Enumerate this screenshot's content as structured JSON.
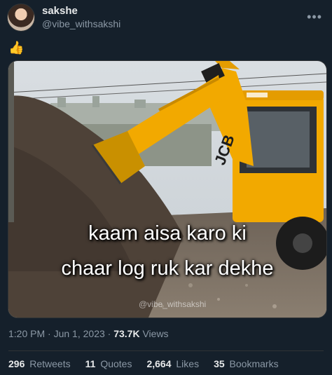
{
  "author": {
    "display_name": "sakshe",
    "handle": "@vibe_withsakshi"
  },
  "tweet": {
    "text": "👍",
    "menu_icon": "more-icon"
  },
  "media": {
    "caption_line1": "kaam aisa karo ki",
    "caption_line2": "chaar log ruk kar dekhe",
    "watermark": "@vibe_withsakshi",
    "brand_text": "JCB"
  },
  "meta": {
    "time": "1:20 PM",
    "date": "Jun 1, 2023",
    "views": "73.7K",
    "views_label": "Views"
  },
  "stats": [
    {
      "value": "296",
      "label": "Retweets"
    },
    {
      "value": "11",
      "label": "Quotes"
    },
    {
      "value": "2,664",
      "label": "Likes"
    },
    {
      "value": "35",
      "label": "Bookmarks"
    }
  ],
  "colors": {
    "background": "#15202b",
    "secondary_text": "#8b98a5",
    "jcb_yellow": "#f2a900"
  }
}
